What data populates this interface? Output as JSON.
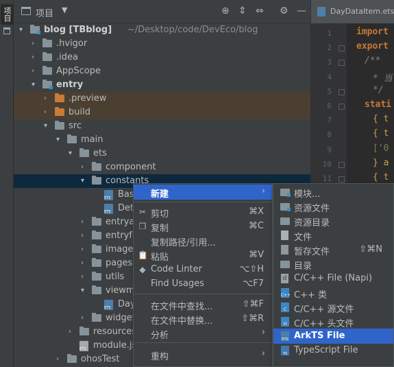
{
  "sidebar_tab": {
    "label": "项目"
  },
  "panel": {
    "title": "项目",
    "caret": "▼",
    "actions": [
      {
        "name": "locate-icon",
        "glyph": "⊕"
      },
      {
        "name": "expand-all-icon",
        "glyph": "⇕"
      },
      {
        "name": "collapse-all-icon",
        "glyph": "⇔"
      },
      {
        "name": "gear-icon",
        "glyph": "⚙"
      },
      {
        "name": "hide-icon",
        "glyph": "—"
      }
    ]
  },
  "tree": [
    {
      "label": "blog [TBblog]",
      "path": " ~/Desktop/code/DevEco/blog",
      "arrow": "▾",
      "icon": "module",
      "bold": true
    },
    {
      "label": ".hvigor",
      "arrow": "›",
      "icon": "folder"
    },
    {
      "label": ".idea",
      "arrow": "›",
      "icon": "folder"
    },
    {
      "label": "AppScope",
      "arrow": "›",
      "icon": "folder"
    },
    {
      "label": "entry",
      "arrow": "▾",
      "icon": "module",
      "bold": true
    },
    {
      "label": ".preview",
      "arrow": "›",
      "icon": "orange-folder"
    },
    {
      "label": "build",
      "arrow": "›",
      "icon": "orange-folder"
    },
    {
      "label": "src",
      "arrow": "▾",
      "icon": "folder"
    },
    {
      "label": "main",
      "arrow": "▾",
      "icon": "folder"
    },
    {
      "label": "ets",
      "arrow": "▾",
      "icon": "folder"
    },
    {
      "label": "component",
      "arrow": "›",
      "icon": "folder"
    },
    {
      "label": "constants",
      "arrow": "▾",
      "icon": "folder"
    },
    {
      "label": "Bas",
      "arrow": "",
      "icon": "ets-file"
    },
    {
      "label": "Det",
      "arrow": "",
      "icon": "ets-file"
    },
    {
      "label": "entrya",
      "arrow": "›",
      "icon": "folder"
    },
    {
      "label": "entryfo",
      "arrow": "›",
      "icon": "folder"
    },
    {
      "label": "images",
      "arrow": "›",
      "icon": "folder"
    },
    {
      "label": "pages",
      "arrow": "›",
      "icon": "folder"
    },
    {
      "label": "utils",
      "arrow": "›",
      "icon": "folder"
    },
    {
      "label": "viewm",
      "arrow": "▾",
      "icon": "folder"
    },
    {
      "label": "Day",
      "arrow": "",
      "icon": "ets-file"
    },
    {
      "label": "widget",
      "arrow": "›",
      "icon": "folder"
    },
    {
      "label": "resources",
      "arrow": "›",
      "icon": "folder"
    },
    {
      "label": "module.js",
      "arrow": "",
      "icon": "js-file"
    },
    {
      "label": "ohosTest",
      "arrow": "›",
      "icon": "folder"
    }
  ],
  "editor": {
    "tab_label": "DayDataItem.ets",
    "line_numbers": [
      "1",
      "2",
      "3",
      "4",
      "5",
      "6",
      "7",
      "8",
      "9",
      "10",
      "11",
      "12",
      "13",
      "14",
      "15",
      "16",
      "17",
      "18",
      "19"
    ],
    "lines": [
      {
        "text": "import",
        "cls": "kw"
      },
      {
        "text": "export",
        "cls": "kw"
      },
      {
        "text": "/**",
        "cls": "cm"
      },
      {
        "text": "* 当",
        "cls": "cm"
      },
      {
        "text": "*/",
        "cls": "cm"
      },
      {
        "text": "stati",
        "cls": "kw"
      },
      {
        "text": "{ t",
        "cls": "br"
      },
      {
        "text": "{ t",
        "cls": "br"
      },
      {
        "text": "['0",
        "cls": "st"
      },
      {
        "text": "} a",
        "cls": "br"
      },
      {
        "text": "{ t",
        "cls": "br"
      },
      {
        "text": "'0",
        "cls": "st"
      },
      {
        "text": "",
        "cls": ""
      },
      {
        "text": "'",
        "cls": "st"
      },
      {
        "text": "",
        "cls": ""
      },
      {
        "text": "'",
        "cls": "st"
      },
      {
        "text": "",
        "cls": ""
      },
      {
        "text": "",
        "cls": ""
      },
      {
        "text": "a",
        "cls": "br"
      }
    ]
  },
  "context_menu": {
    "items": [
      {
        "label": "新建",
        "shortcut": "",
        "submenu": true,
        "selected": true,
        "icon": ""
      },
      {
        "label": "剪切",
        "shortcut": "⌘X",
        "submenu": false,
        "icon": "✂"
      },
      {
        "label": "复制",
        "shortcut": "⌘C",
        "submenu": false,
        "icon": "❐"
      },
      {
        "label": "复制路径/引用...",
        "shortcut": "",
        "submenu": false,
        "icon": ""
      },
      {
        "label": "粘贴",
        "shortcut": "⌘V",
        "submenu": false,
        "icon": "📋"
      },
      {
        "label": "Code Linter",
        "shortcut": "⌥⇧H",
        "submenu": false,
        "icon": "◆"
      },
      {
        "label": "Find Usages",
        "shortcut": "⌥F7",
        "submenu": false,
        "icon": ""
      },
      {
        "label": "在文件中查找...",
        "shortcut": "⇧⌘F",
        "submenu": false,
        "icon": ""
      },
      {
        "label": "在文件中替换...",
        "shortcut": "⇧⌘R",
        "submenu": false,
        "icon": ""
      },
      {
        "label": "分析",
        "shortcut": "",
        "submenu": true,
        "icon": ""
      },
      {
        "label": "重构",
        "shortcut": "",
        "submenu": true,
        "icon": ""
      }
    ]
  },
  "submenu": {
    "items": [
      {
        "label": "模块...",
        "shortcut": "",
        "icon": "module-folder"
      },
      {
        "label": "资源文件",
        "shortcut": "",
        "icon": "module-folder"
      },
      {
        "label": "资源目录",
        "shortcut": "",
        "icon": "folder"
      },
      {
        "label": "文件",
        "shortcut": "",
        "icon": "doc"
      },
      {
        "label": "暂存文件",
        "shortcut": "⇧⌘N",
        "icon": "scratch"
      },
      {
        "label": "目录",
        "shortcut": "",
        "icon": "folder"
      },
      {
        "label": "C/C++ File (Napi)",
        "shortcut": "",
        "icon": "napi",
        "glyph": "d"
      },
      {
        "label": "C++ 类",
        "shortcut": "",
        "icon": "cpp",
        "glyph": "C++"
      },
      {
        "label": "C/C++ 源文件",
        "shortcut": "",
        "icon": "cpp",
        "glyph": "C"
      },
      {
        "label": "C/C++ 头文件",
        "shortcut": "",
        "icon": "cpp",
        "glyph": "H"
      },
      {
        "label": "ArkTS File",
        "shortcut": "",
        "icon": "ets",
        "glyph": "ETS",
        "selected": true
      },
      {
        "label": "TypeScript File",
        "shortcut": "",
        "icon": "ts",
        "glyph": "TS"
      }
    ]
  }
}
